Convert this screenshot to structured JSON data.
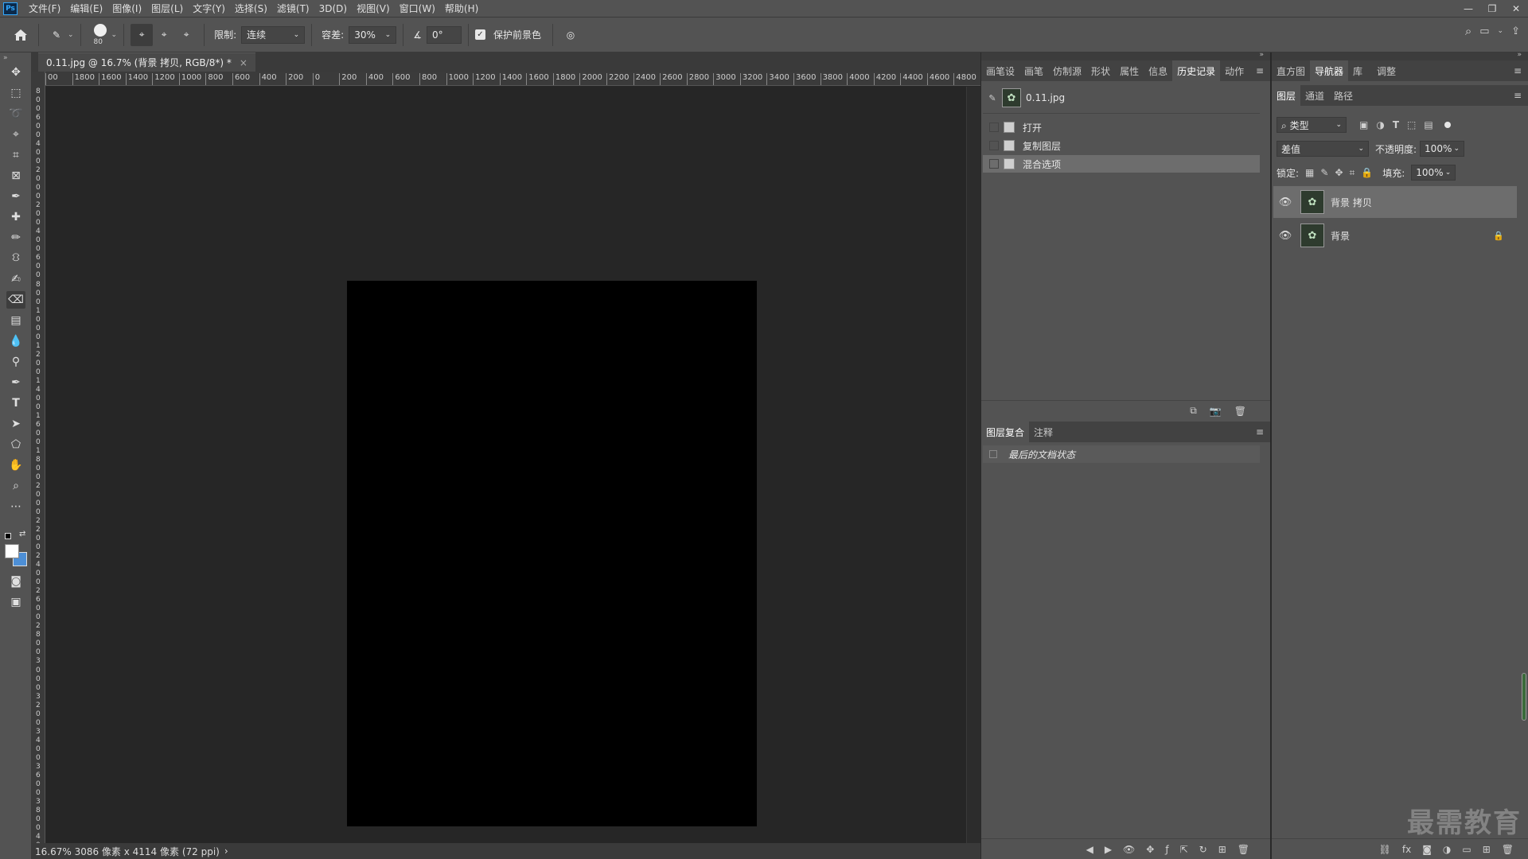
{
  "app": {
    "logo": "Ps"
  },
  "menu": [
    "文件(F)",
    "编辑(E)",
    "图像(I)",
    "图层(L)",
    "文字(Y)",
    "选择(S)",
    "滤镜(T)",
    "3D(D)",
    "视图(V)",
    "窗口(W)",
    "帮助(H)"
  ],
  "window_controls": [
    "minimize-icon",
    "restore-icon",
    "close-icon"
  ],
  "options": {
    "brush_size": "80",
    "limit_label": "限制:",
    "limit_value": "连续",
    "tolerance_label": "容差:",
    "tolerance_value": "30%",
    "angle_symbol": "∡",
    "angle_value": "0°",
    "protect_fg_label": "保护前景色",
    "protect_fg_checked": true
  },
  "document": {
    "tab_title": "0.11.jpg @ 16.7% (背景 拷贝, RGB/8*) *",
    "close": "×",
    "status": "16.67%  3086 像素 x 4114 像素 (72 ppi)",
    "status_arrow": "›",
    "canvas_color": "#000000"
  },
  "ruler": {
    "h_ticks": [
      "00",
      "1800",
      "1600",
      "1400",
      "1200",
      "1000",
      "800",
      "600",
      "400",
      "200",
      "0",
      "200",
      "400",
      "600",
      "800",
      "1000",
      "1200",
      "1400",
      "1600",
      "1800",
      "2000",
      "2200",
      "2400",
      "2600",
      "2800",
      "3000",
      "3200",
      "3400",
      "3600",
      "3800",
      "4000",
      "4200",
      "4400",
      "4600",
      "4800"
    ],
    "v_ticks": [
      "8",
      "0",
      "0",
      "6",
      "0",
      "0",
      "4",
      "0",
      "0",
      "2",
      "0",
      "0",
      "0",
      "2",
      "0",
      "0",
      "4",
      "0",
      "0",
      "6",
      "0",
      "0",
      "8",
      "0",
      "0",
      "1",
      "0",
      "0",
      "0",
      "1",
      "2",
      "0",
      "0",
      "1",
      "4",
      "0",
      "0",
      "1",
      "6",
      "0",
      "0",
      "1",
      "8",
      "0",
      "0",
      "2",
      "0",
      "0",
      "0",
      "2",
      "2",
      "0",
      "0",
      "2",
      "4",
      "0",
      "0",
      "2",
      "6",
      "0",
      "0",
      "2",
      "8",
      "0",
      "0",
      "3",
      "0",
      "0",
      "0",
      "3",
      "2",
      "0",
      "0",
      "3",
      "4",
      "0",
      "0",
      "3",
      "6",
      "0",
      "0",
      "3",
      "8",
      "0",
      "0",
      "4",
      "0",
      "0"
    ]
  },
  "history_panel": {
    "tabs": [
      "画笔设",
      "画笔",
      "仿制源",
      "形状",
      "属性",
      "信息",
      "历史记录",
      "动作"
    ],
    "active_tab": "历史记录",
    "snapshot": "0.11.jpg",
    "items": [
      "打开",
      "复制图层",
      "混合选项"
    ],
    "selected_item": "混合选项"
  },
  "comps_panel": {
    "tabs": [
      "图层复合",
      "注释"
    ],
    "active_tab": "图层复合",
    "item": "最后的文档状态"
  },
  "top_right_panel": {
    "tabs": [
      "直方图",
      "导航器",
      "库",
      "调整"
    ],
    "active_tab": "导航器"
  },
  "layers_panel": {
    "tabs": [
      "图层",
      "通道",
      "路径"
    ],
    "active_tab": "图层",
    "filter_label": "类型",
    "blend_mode": "差值",
    "opacity_label": "不透明度:",
    "opacity_value": "100%",
    "lock_label": "锁定:",
    "fill_label": "填充:",
    "fill_value": "100%",
    "layers": [
      {
        "name": "背景 拷贝",
        "visible": true,
        "selected": true,
        "locked": false
      },
      {
        "name": "背景",
        "visible": true,
        "selected": false,
        "locked": true
      }
    ]
  },
  "watermark": "最需教育"
}
